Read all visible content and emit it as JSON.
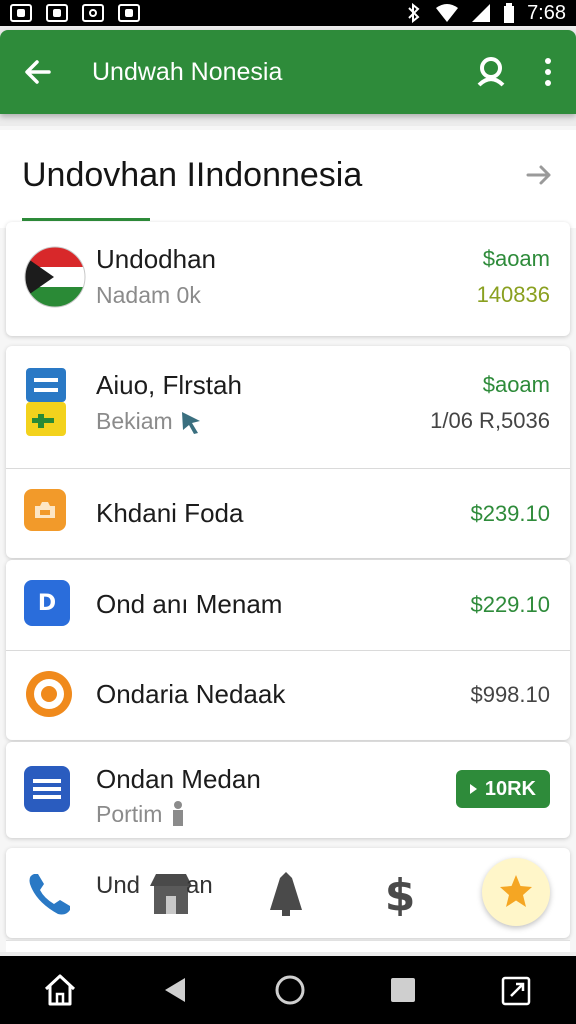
{
  "status_bar": {
    "time": "7:68",
    "icons": [
      "gallery-icon",
      "photo-icon",
      "sync-icon",
      "shop-icon",
      "bluetooth-icon",
      "wifi-icon",
      "signal-icon",
      "battery-icon"
    ]
  },
  "app_bar": {
    "title": "Undwah Nonesia",
    "color": "#2e8b3a"
  },
  "header": {
    "title": "Undovhan IIndonnesia"
  },
  "items": [
    {
      "name": "Undodhan",
      "sub": "Nadam 0k",
      "amount": "$aoam",
      "amount2": "140836",
      "icon": "flag-icon"
    },
    {
      "name": "Aiuo, Flrstah",
      "sub": "Bekiam",
      "amount": "$aoam",
      "amount2": "1/06 R,5036",
      "icon": "document-icon"
    },
    {
      "name": "Khdani Foda",
      "amount": "$239.10",
      "icon": "folder-icon"
    },
    {
      "name": "Ond anı Menam",
      "amount": "$229.10",
      "icon": "app-d-icon"
    },
    {
      "name": "Ondaria Nedaak",
      "amount": "$998.10",
      "icon": "target-icon"
    },
    {
      "name": "Ondan Medan",
      "sub": "Portim",
      "badge": "10RK",
      "icon": "list-icon"
    }
  ],
  "bottom_row": {
    "label": "Und",
    "label_tail": "an"
  },
  "nav_bar": {
    "buttons": [
      "home-icon",
      "back-icon",
      "home-circle-icon",
      "recents-icon",
      "rotate-icon"
    ]
  }
}
